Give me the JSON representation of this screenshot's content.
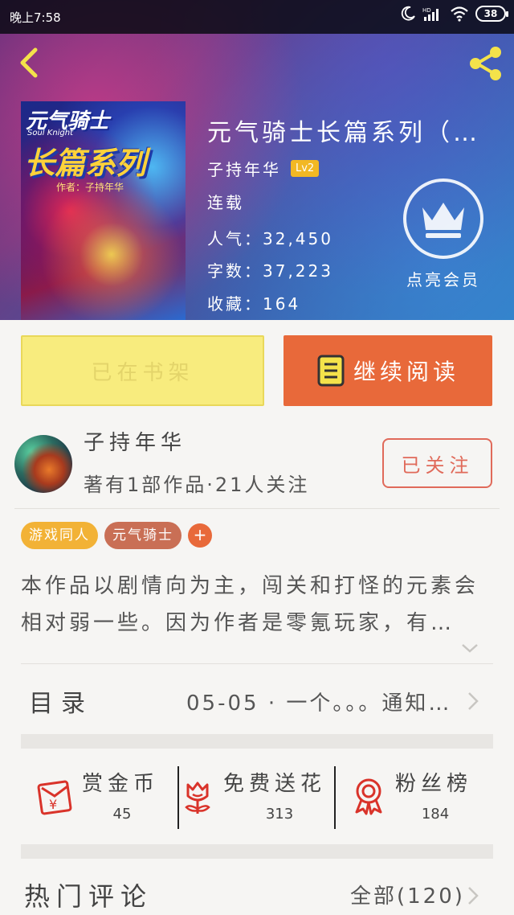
{
  "status_bar": {
    "time": "晚上7:58",
    "battery": "38",
    "network": "HD"
  },
  "header": {
    "back_icon": "chevron-left-icon",
    "share_icon": "share-icon"
  },
  "book": {
    "cover_title_top": "元气骑士",
    "cover_subtitle": "Soul Knight",
    "cover_title_main": "长篇系列",
    "cover_author": "作者：子持年华",
    "title": "元气骑士长篇系列（…",
    "author": "子持年华",
    "level": "Lv2",
    "status": "连载",
    "popularity": "人气：32,450",
    "word_count": "字数：37,223",
    "favorites": "收藏：164"
  },
  "vip": {
    "label": "点亮会员",
    "icon": "crown-icon"
  },
  "actions": {
    "shelf_label": "已在书架",
    "read_label": "继续阅读",
    "read_icon": "book-icon"
  },
  "author_card": {
    "name": "子持年华",
    "stats": "著有1部作品·21人关注",
    "follow_label": "已关注"
  },
  "tags": [
    {
      "label": "游戏同人",
      "color": "#f2b236"
    },
    {
      "label": "元气骑士",
      "color": "#c96f55"
    }
  ],
  "description": "本作品以剧情向为主，闯关和打怪的元素会相对弱一些。因为作者是零氪玩家，有…",
  "catalog": {
    "label": "目录",
    "latest": "05-05 · 一个。。。通知…"
  },
  "stats": [
    {
      "label": "赏金币",
      "value": "45",
      "icon": "red-envelope-icon"
    },
    {
      "label": "免费送花",
      "value": "313",
      "icon": "flower-icon"
    },
    {
      "label": "粉丝榜",
      "value": "184",
      "icon": "medal-icon"
    }
  ],
  "comments": {
    "title": "热门评论",
    "all_label": "全部(120)"
  },
  "colors": {
    "accent": "#e8693a",
    "shelf_bg": "#f8ec7e",
    "follow": "#e06a5a",
    "icon_red": "#d9332a"
  }
}
